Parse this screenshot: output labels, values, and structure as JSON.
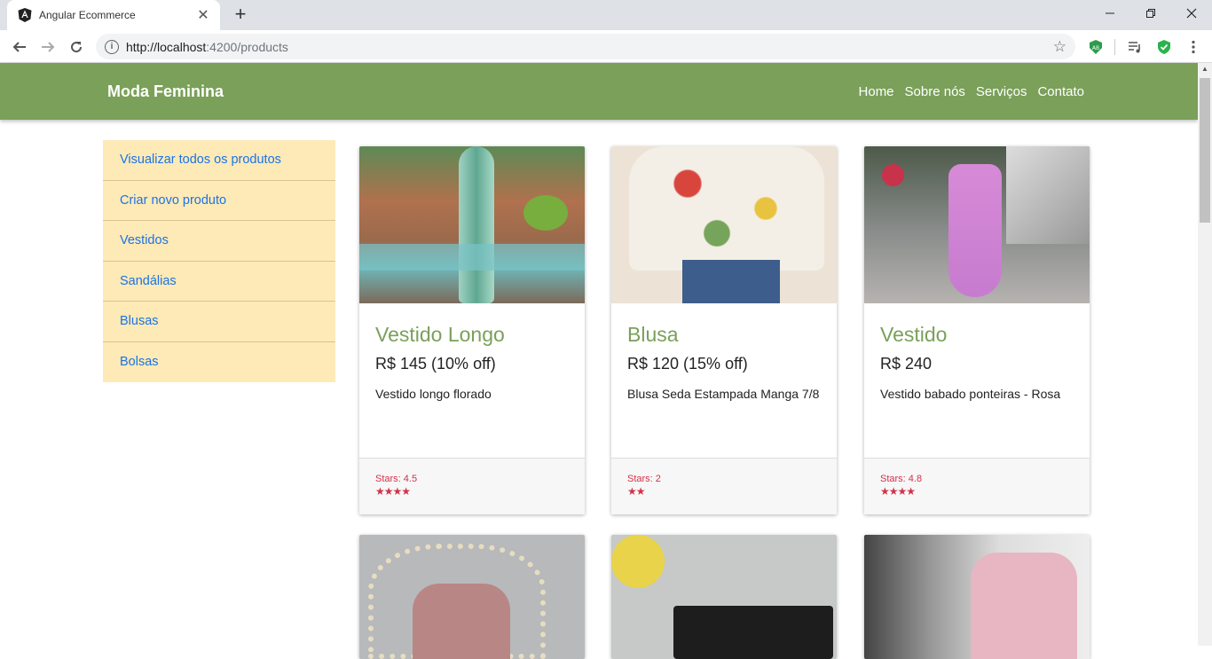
{
  "browser": {
    "tab_title": "Angular Ecommerce",
    "url_host": "http://localhost",
    "url_path": ":4200/products"
  },
  "header": {
    "brand": "Moda Feminina",
    "nav": [
      "Home",
      "Sobre nós",
      "Serviços",
      "Contato"
    ]
  },
  "sidebar": {
    "items": [
      {
        "label": "Visualizar todos os produtos"
      },
      {
        "label": "Criar novo produto"
      },
      {
        "label": "Vestidos"
      },
      {
        "label": "Sandálias"
      },
      {
        "label": "Blusas"
      },
      {
        "label": "Bolsas"
      }
    ]
  },
  "products": [
    {
      "title": "Vestido Longo",
      "price": "R$ 145 (10% off)",
      "description": "Vestido longo florado",
      "stars_label": "Stars: 4.5",
      "rating": 4.5
    },
    {
      "title": "Blusa",
      "price": "R$ 120 (15% off)",
      "description": "Blusa Seda Estampada Manga 7/8",
      "stars_label": "Stars: 2",
      "rating": 2
    },
    {
      "title": "Vestido",
      "price": "R$ 240",
      "description": "Vestido babado ponteiras - Rosa",
      "stars_label": "Stars: 4.8",
      "rating": 4.8
    }
  ],
  "colors": {
    "header": "#7aa05a",
    "sidebar": "#fdeab7",
    "link": "#1a73e8",
    "stars": "#d0324b"
  }
}
